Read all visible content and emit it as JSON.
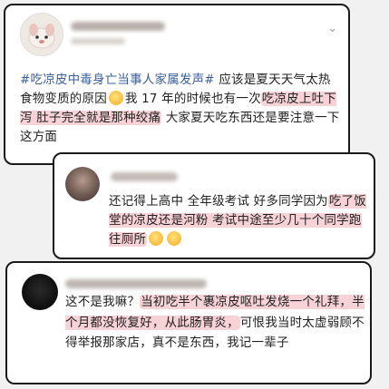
{
  "posts": [
    {
      "hashtag": "#吃凉皮中毒身亡当事人家属发声#",
      "segments": [
        {
          "text": " 应该是夏天天气太热食物变质的原因",
          "hl": false
        },
        {
          "text": "我 17 年的时候也有一次",
          "hl": false
        },
        {
          "text": "吃凉皮上吐下泻 肚子完全就是那种绞痛",
          "hl": true
        },
        {
          "text": " 大家夏天吃东西还是要注意一下这方面",
          "hl": false
        }
      ]
    },
    {
      "segments": [
        {
          "text": "还记得上高中 全年级考试 好多同学因为",
          "hl": false
        },
        {
          "text": "吃了饭堂的凉皮还是河粉 考试中途至少几十个同学跑往厕所",
          "hl": true
        }
      ]
    },
    {
      "segments": [
        {
          "text": "这不是我嘛？",
          "hl": false
        },
        {
          "text": "当初吃半个裹凉皮呕吐发烧一个礼拜，半个月都没恢复好，从此肠胃炎，",
          "hl": true
        },
        {
          "text": "可恨我当时太虚弱顾不得举报那家店，真不是东西，我记一辈子",
          "hl": false
        }
      ]
    }
  ],
  "icons": {
    "more": "chevron-down-icon",
    "emoji": "face-emoji-icon"
  },
  "colors": {
    "highlight": "#f7d2d7",
    "hashtag": "#3a5f9c",
    "card_border": "#1a1a1a"
  }
}
